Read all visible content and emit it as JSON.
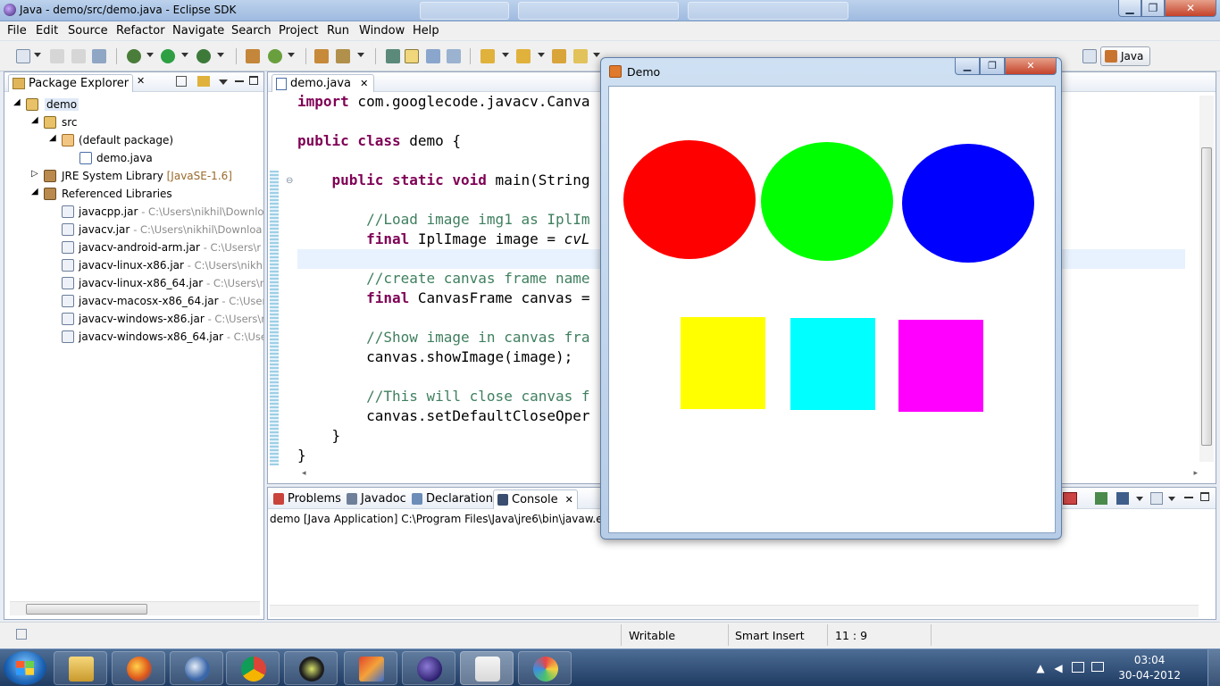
{
  "window": {
    "title": "Java - demo/src/demo.java - Eclipse SDK",
    "min_label": "▁",
    "max_label": "❐",
    "close_label": "✕"
  },
  "menu": [
    "File",
    "Edit",
    "Source",
    "Refactor",
    "Navigate",
    "Search",
    "Project",
    "Run",
    "Window",
    "Help"
  ],
  "perspective": {
    "label": "Java"
  },
  "package_explorer": {
    "tab_label": "Package Explorer",
    "close_glyph": "✕",
    "items": [
      {
        "label": "demo",
        "icon": "project-icon",
        "extra": ""
      },
      {
        "label": "src",
        "icon": "source-folder-icon",
        "extra": ""
      },
      {
        "label": "(default package)",
        "icon": "package-icon",
        "extra": ""
      },
      {
        "label": "demo.java",
        "icon": "java-file-icon",
        "extra": ""
      },
      {
        "label": "JRE System Library",
        "icon": "library-icon",
        "extra": "[JavaSE-1.6]"
      },
      {
        "label": "Referenced Libraries",
        "icon": "library-icon",
        "extra": ""
      },
      {
        "label": "javacpp.jar",
        "icon": "jar-icon",
        "extra": "- C:\\Users\\nikhil\\Downlo"
      },
      {
        "label": "javacv.jar",
        "icon": "jar-icon",
        "extra": "- C:\\Users\\nikhil\\Downloa"
      },
      {
        "label": "javacv-android-arm.jar",
        "icon": "jar-icon",
        "extra": "- C:\\Users\\r"
      },
      {
        "label": "javacv-linux-x86.jar",
        "icon": "jar-icon",
        "extra": "- C:\\Users\\nikhil"
      },
      {
        "label": "javacv-linux-x86_64.jar",
        "icon": "jar-icon",
        "extra": "- C:\\Users\\ni"
      },
      {
        "label": "javacv-macosx-x86_64.jar",
        "icon": "jar-icon",
        "extra": "- C:\\Users"
      },
      {
        "label": "javacv-windows-x86.jar",
        "icon": "jar-icon",
        "extra": "- C:\\Users\\r"
      },
      {
        "label": "javacv-windows-x86_64.jar",
        "icon": "jar-icon",
        "extra": "- C:\\Use"
      }
    ]
  },
  "editor": {
    "tab_label": "demo.java",
    "close_glyph": "✕",
    "lines": {
      "l1_kw": "import",
      "l1_rest": " com.googlecode.javacv.Canva",
      "l2_kw": "public class",
      "l2_rest": " demo {",
      "l3_kw": "public static void",
      "l3_rest": " main(String",
      "l4_cm": "//Load image img1 as IplIm",
      "l5_kw": "final",
      "l5_rest": " IplImage image = ",
      "l5_it": "cvL",
      "l6_cm": "//create canvas frame name",
      "l7_kw": "final",
      "l7_rest": " CanvasFrame canvas =",
      "l8_cm": "//Show image in canvas fra",
      "l9": "canvas.showImage(image);",
      "l10_cm": "//This will close canvas f",
      "l11": "canvas.setDefaultCloseOper",
      "l12": "}",
      "l13": "}"
    }
  },
  "console": {
    "tabs": [
      "Problems",
      "Javadoc",
      "Declaration",
      "Console"
    ],
    "active_tab": "Console",
    "close_glyph": "✕",
    "status": "demo [Java Application] C:\\Program Files\\Java\\jre6\\bin\\javaw.ex"
  },
  "statusbar": {
    "writable": "Writable",
    "insert_mode": "Smart Insert",
    "position": "11 : 9"
  },
  "demo_window": {
    "title": "Demo",
    "shapes": [
      {
        "type": "ellipse",
        "color": "#ff0000"
      },
      {
        "type": "ellipse",
        "color": "#00ff00"
      },
      {
        "type": "ellipse",
        "color": "#0000ff"
      },
      {
        "type": "rectangle",
        "color": "#ffff00"
      },
      {
        "type": "rectangle",
        "color": "#00ffff"
      },
      {
        "type": "rectangle",
        "color": "#ff00ff"
      }
    ]
  },
  "taskbar": {
    "apps": [
      "windows-explorer",
      "firefox",
      "thunderbird",
      "chrome",
      "app-5",
      "app-6",
      "eclipse",
      "java",
      "paint"
    ],
    "time": "03:04",
    "date": "30-04-2012"
  }
}
